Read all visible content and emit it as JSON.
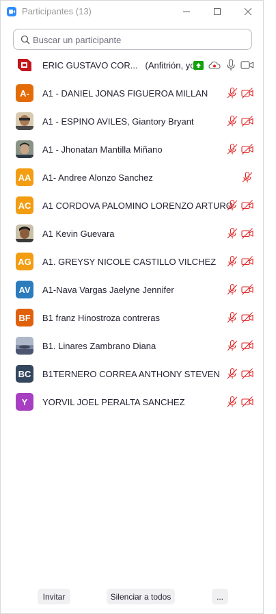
{
  "window": {
    "title": "Participantes (13)"
  },
  "search": {
    "placeholder": "Buscar un participante"
  },
  "host": {
    "name": "ERIC GUSTAVO COR...",
    "tag": "(Anfitrión, yo)"
  },
  "participants": [
    {
      "name": "A1 - DANIEL JONAS FIGUEROA MILLAN",
      "initials": "A-",
      "color": "#e36c09"
    },
    {
      "name": "A1 - ESPINO AVILES, Giantory Bryant",
      "initials": "",
      "color": "#b08a62"
    },
    {
      "name": "A1 - Jhonatan Mantilla Miñano",
      "initials": "",
      "color": "#6d7a6a"
    },
    {
      "name": "A1- Andree Alonzo Sanchez",
      "initials": "AA",
      "color": "#f29d12"
    },
    {
      "name": "A1 CORDOVA PALOMINO LORENZO ARTURO",
      "initials": "AC",
      "color": "#f29d12"
    },
    {
      "name": "A1 Kevin Guevara",
      "initials": "",
      "color": "#7a6b4f"
    },
    {
      "name": "A1. GREYSY NICOLE CASTILLO VILCHEZ",
      "initials": "AG",
      "color": "#f29d12"
    },
    {
      "name": "A1-Nava Vargas Jaelyne Jennifer",
      "initials": "AV",
      "color": "#2b7bbd"
    },
    {
      "name": "B1 franz Hinostroza contreras",
      "initials": "BF",
      "color": "#e0600c"
    },
    {
      "name": "B1. Linares Zambrano Diana",
      "initials": "",
      "color": "#5d6c86"
    },
    {
      "name": "B1TERNERO CORREA ANTHONY STEVEN",
      "initials": "BC",
      "color": "#34475f"
    },
    {
      "name": "YORVIL JOEL PERALTA SANCHEZ",
      "initials": "Y",
      "color": "#a83fc2"
    }
  ],
  "footer": {
    "invite_label": "Invitar",
    "mute_all_label": "Silenciar a todos",
    "more_label": "..."
  },
  "colors": {
    "muted_red": "#e02828",
    "accent": "#2d8cff"
  }
}
